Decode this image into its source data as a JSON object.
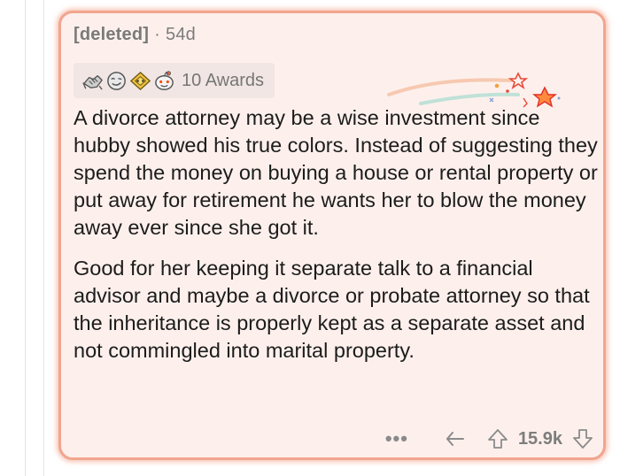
{
  "comment": {
    "author": "[deleted]",
    "separator": "·",
    "age": "54d",
    "awards": {
      "count_label": "10 Awards",
      "icons": [
        "silver-handshake-award-icon",
        "wink-face-award-icon",
        "gold-bow-award-icon",
        "snoo-face-award-icon"
      ]
    },
    "paragraphs": [
      "A divorce attorney may be a wise investment since hubby showed his true colors. Instead of suggesting they spend the money on buying a house or rental property or put away for retirement he wants her to blow the money away ever since she got it.",
      "Good for her keeping it separate talk to a financial advisor and maybe a divorce or probate attorney so that the inheritance is properly kept as a separate asset and not commingled into marital property."
    ],
    "actions": {
      "more_label": "•••",
      "score": "15.9k"
    }
  },
  "colors": {
    "card_background": "#fdf0ec",
    "card_border": "#f1a58f",
    "meta_text": "#7c7c7c",
    "body_text": "#1c1c1c"
  }
}
